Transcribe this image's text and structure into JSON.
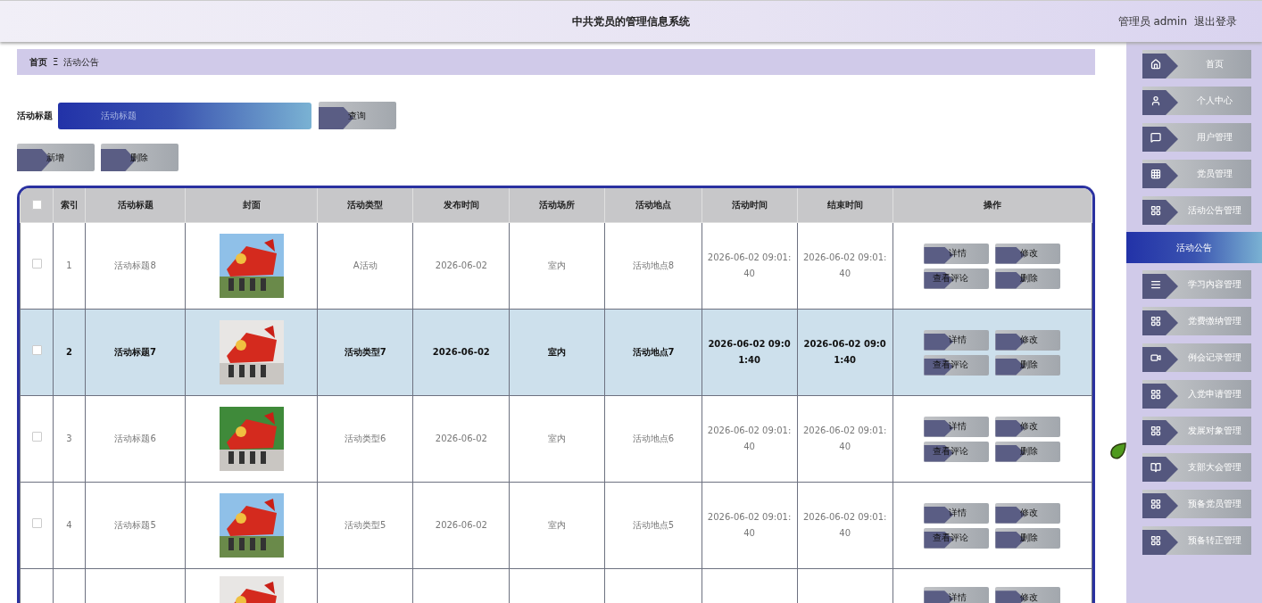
{
  "header": {
    "title": "中共党员的管理信息系统",
    "user": "管理员 admin",
    "logout": "退出登录"
  },
  "breadcrumb": {
    "home": "首页",
    "separator": "Ξ",
    "current": "活动公告"
  },
  "search": {
    "label": "活动标题",
    "placeholder": "活动标题",
    "button": "查询"
  },
  "toolbar": [
    "新增",
    "删除"
  ],
  "table": {
    "select_all_checked": false,
    "columns": [
      "索引",
      "活动标题",
      "封面",
      "活动类型",
      "发布时间",
      "活动场所",
      "活动地点",
      "活动时间",
      "结束时间",
      "操作"
    ],
    "rows": [
      {
        "index": "1",
        "title": "活动标题8",
        "cover": {
          "kind": "picture"
        },
        "type": "A活动",
        "published": "2026-06-02",
        "venue": "室内",
        "location": "活动地点8",
        "start": "2026-06-02 09:01:40",
        "end": "2026-06-02 09:01:40",
        "actions": [
          "详情",
          "修改",
          "查看评论",
          "删除"
        ],
        "selected": false,
        "checked": false
      },
      {
        "index": "2",
        "title": "活动标题7",
        "cover": {
          "kind": "picture"
        },
        "type": "活动类型7",
        "published": "2026-06-02",
        "venue": "室内",
        "location": "活动地点7",
        "start": "2026-06-02 09:01:40",
        "end": "2026-06-02 09:01:40",
        "actions": [
          "详情",
          "修改",
          "查看评论",
          "删除"
        ],
        "selected": true,
        "checked": false
      },
      {
        "index": "3",
        "title": "活动标题6",
        "cover": {
          "kind": "picture"
        },
        "type": "活动类型6",
        "published": "2026-06-02",
        "venue": "室内",
        "location": "活动地点6",
        "start": "2026-06-02 09:01:40",
        "end": "2026-06-02 09:01:40",
        "actions": [
          "详情",
          "修改",
          "查看评论",
          "删除"
        ],
        "selected": false,
        "checked": false
      },
      {
        "index": "4",
        "title": "活动标题5",
        "cover": {
          "kind": "picture"
        },
        "type": "活动类型5",
        "published": "2026-06-02",
        "venue": "室内",
        "location": "活动地点5",
        "start": "2026-06-02 09:01:40",
        "end": "2026-06-02 09:01:40",
        "actions": [
          "详情",
          "修改",
          "查看评论",
          "删除"
        ],
        "selected": false,
        "checked": false
      },
      {
        "cover": {
          "kind": "picture"
        },
        "actions": [
          "详情",
          "修改"
        ],
        "selected": false
      }
    ]
  },
  "sidebar": {
    "items": [
      {
        "label": "首页",
        "selected": false
      },
      {
        "label": "个人中心",
        "selected": false
      },
      {
        "label": "用户管理",
        "selected": false
      },
      {
        "label": "党员管理",
        "selected": false
      },
      {
        "label": "活动公告管理",
        "selected": false
      },
      {
        "label": "活动公告",
        "selected": true
      },
      {
        "label": "学习内容管理",
        "selected": false
      },
      {
        "label": "党费缴纳管理",
        "selected": false
      },
      {
        "label": "例会记录管理",
        "selected": false
      },
      {
        "label": "入党申请管理",
        "selected": false
      },
      {
        "label": "发展对象管理",
        "selected": false
      },
      {
        "label": "支部大会管理",
        "selected": false
      },
      {
        "label": "预备党员管理",
        "selected": false
      },
      {
        "label": "预备转正管理",
        "selected": false
      }
    ]
  }
}
